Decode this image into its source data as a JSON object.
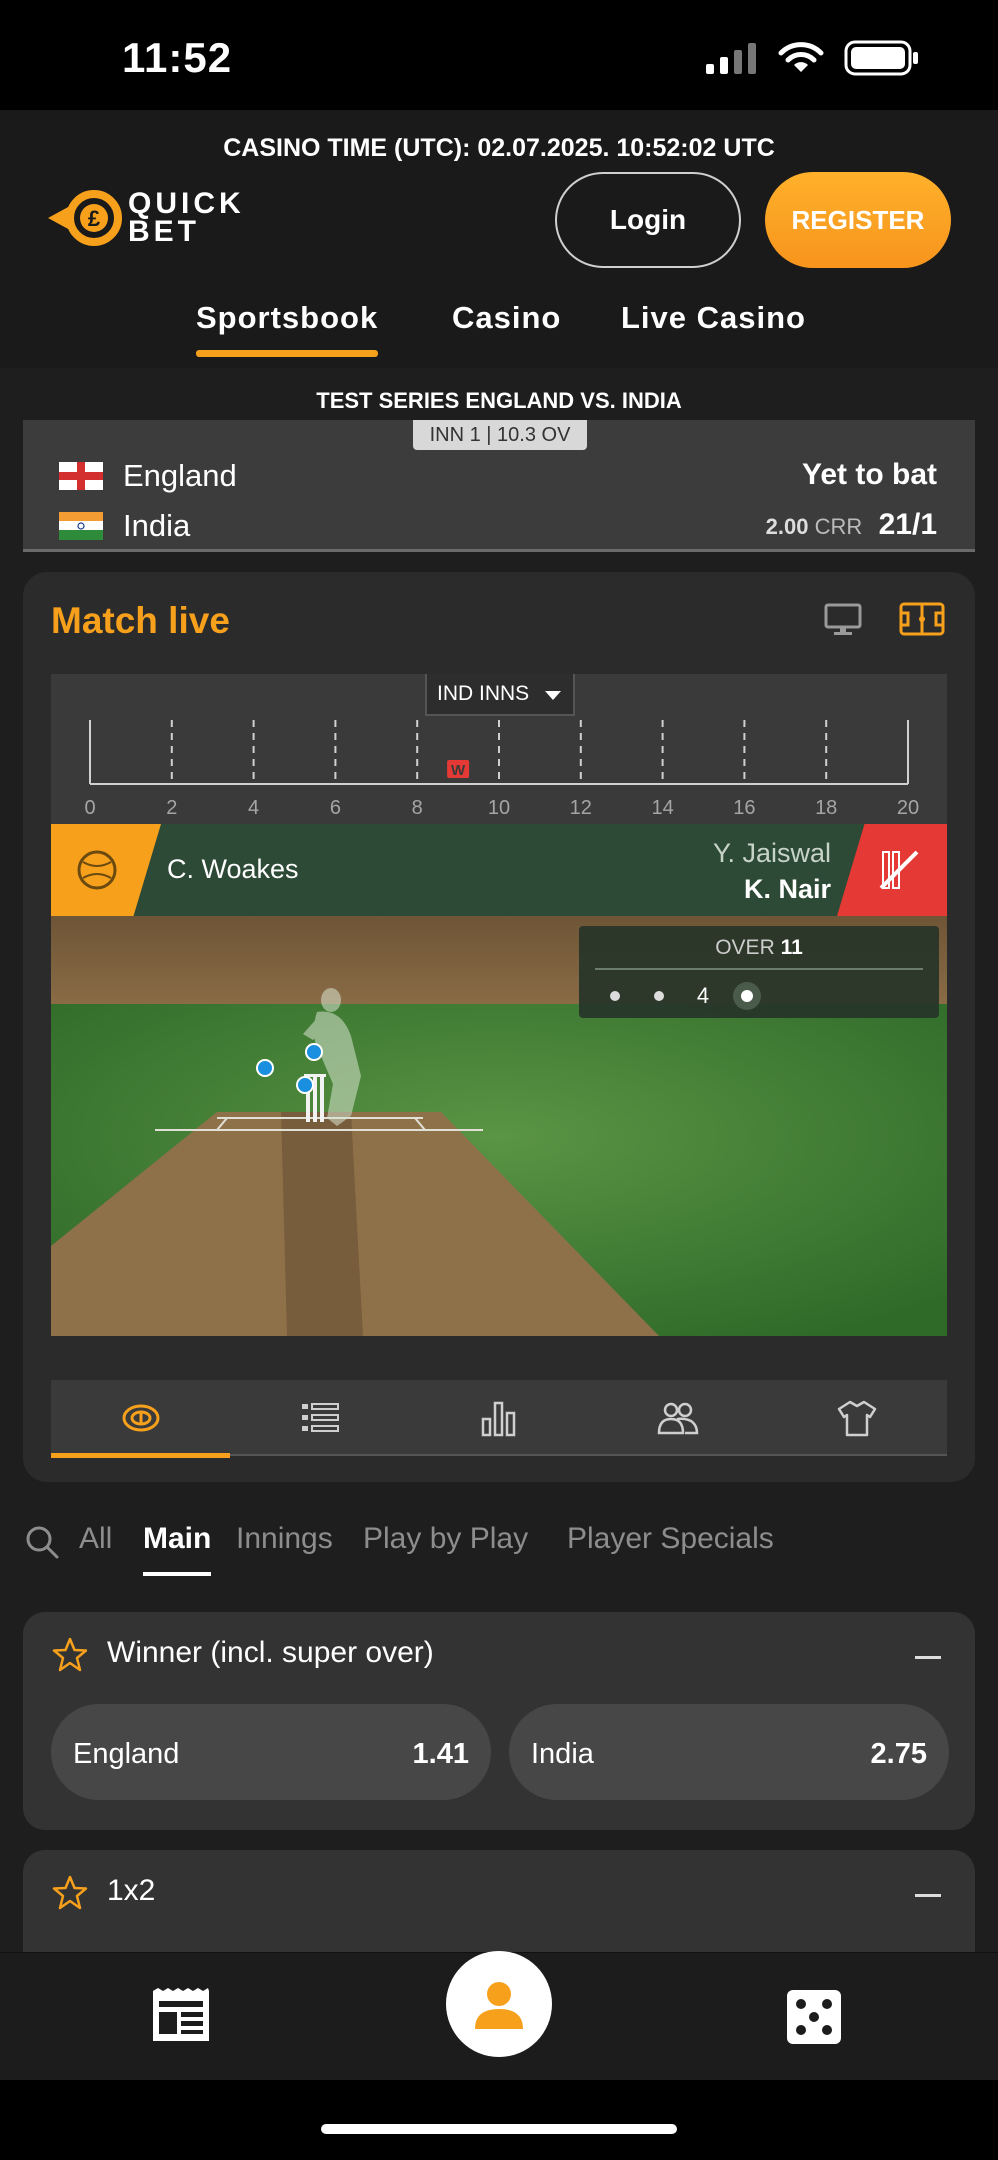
{
  "status_bar": {
    "time": "11:52"
  },
  "header": {
    "casino_time": "CASINO TIME (UTC): 02.07.2025. 10:52:02 UTC",
    "logo_line1": "QUICK",
    "logo_line2": "BET",
    "login_label": "Login",
    "register_label": "REGISTER",
    "nav": [
      "Sportsbook",
      "Casino",
      "Live Casino"
    ],
    "active_nav": "Sportsbook"
  },
  "scoreboard": {
    "series_title": "TEST SERIES ENGLAND VS. INDIA",
    "innings_badge": "INN 1 | 10.3 OV",
    "team1": {
      "name": "England",
      "status": "Yet to bat"
    },
    "team2": {
      "name": "India",
      "crr_value": "2.00",
      "crr_label": "CRR",
      "score": "21/1"
    }
  },
  "match_live": {
    "title": "Match live",
    "innings_select": "IND INNS",
    "timeline_ticks": [
      "0",
      "2",
      "4",
      "6",
      "8",
      "10",
      "12",
      "14",
      "16",
      "18",
      "20"
    ],
    "wicket_marker": "W",
    "bowler": "C. Woakes",
    "batter1": "Y. Jaiswal",
    "batter2": "K. Nair",
    "over_label": "OVER",
    "over_number": "11",
    "over_balls": [
      "•",
      "•",
      "4",
      "current"
    ],
    "tabs": [
      "field-view",
      "commentary",
      "statistics",
      "lineups",
      "kits"
    ],
    "active_tab": "field-view"
  },
  "market_filter": {
    "tabs": [
      "All",
      "Main",
      "Innings",
      "Play by Play",
      "Player Specials"
    ],
    "active": "Main"
  },
  "markets": [
    {
      "title": "Winner (incl. super over)",
      "odds": [
        {
          "label": "England",
          "value": "1.41"
        },
        {
          "label": "India",
          "value": "2.75"
        }
      ]
    },
    {
      "title": "1x2"
    }
  ],
  "colors": {
    "accent": "#f7a01c",
    "background": "#1e1e1e",
    "card": "#2b2b2b",
    "pitch_green": "#3f7a34",
    "wicket_red": "#e53935"
  }
}
